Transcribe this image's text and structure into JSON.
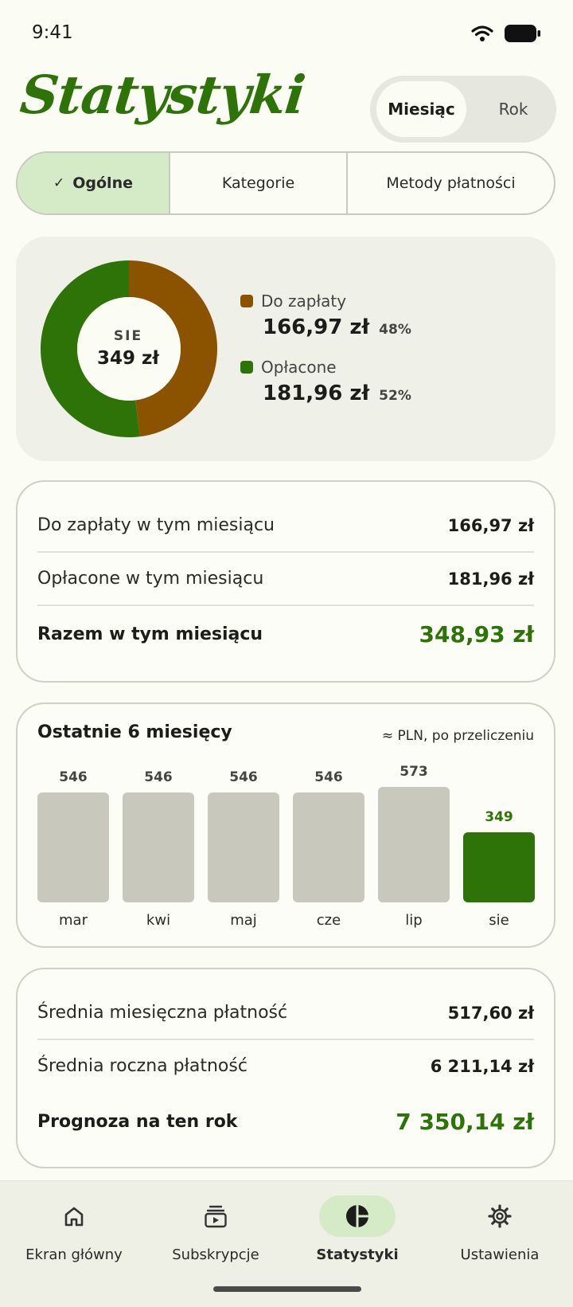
{
  "status_bar": {
    "time": "9:41"
  },
  "header": {
    "title": "Statystyki"
  },
  "period_toggle": {
    "options": [
      "Miesiąc",
      "Rok"
    ],
    "selected": "Miesiąc"
  },
  "segments": {
    "items": [
      "Ogólne",
      "Kategorie",
      "Metody płatności"
    ],
    "selected": "Ogólne",
    "check_glyph": "✓"
  },
  "summary_donut": {
    "center_label": "SIE",
    "center_value": "349 zł",
    "legend": [
      {
        "name": "Do zapłaty",
        "amount": "166,97 zł",
        "percent": "48%",
        "color": "#8b5300"
      },
      {
        "name": "Opłacone",
        "amount": "181,96 zł",
        "percent": "52%",
        "color": "#2e7308"
      }
    ]
  },
  "month_totals": {
    "rows": [
      {
        "label": "Do zapłaty w tym miesiącu",
        "value": "166,97 zł"
      },
      {
        "label": "Opłacone w tym miesiącu",
        "value": "181,96 zł"
      }
    ],
    "total": {
      "label": "Razem w tym miesiącu",
      "value": "348,93 zł"
    }
  },
  "last_months": {
    "title": "Ostatnie 6 miesięcy",
    "note": "≈ PLN, po przeliczeniu"
  },
  "chart_data": {
    "type": "bar",
    "categories": [
      "mar",
      "kwi",
      "maj",
      "cze",
      "lip",
      "sie"
    ],
    "values": [
      546,
      546,
      546,
      546,
      573,
      349
    ],
    "value_labels": [
      "546",
      "546",
      "546",
      "546",
      "573",
      "349"
    ],
    "highlighted": "sie",
    "colors": {
      "default": "#c8c9bc",
      "current": "#2e7308"
    }
  },
  "averages": {
    "rows": [
      {
        "label": "Średnia miesięczna płatność",
        "value": "517,60 zł"
      },
      {
        "label": "Średnia roczna płatność",
        "value": "6 211,14 zł"
      }
    ],
    "total": {
      "label": "Prognoza na ten rok",
      "value": "7 350,14 zł"
    }
  },
  "bottom_nav": {
    "items": [
      {
        "label": "Ekran główny",
        "icon": "home-icon"
      },
      {
        "label": "Subskrypcje",
        "icon": "subscriptions-icon"
      },
      {
        "label": "Statystyki",
        "icon": "statistics-icon"
      },
      {
        "label": "Ustawienia",
        "icon": "settings-icon"
      }
    ],
    "selected": "Statystyki"
  },
  "colors": {
    "accent": "#2e7308",
    "due": "#8b5300",
    "background": "#fbfcf3"
  }
}
